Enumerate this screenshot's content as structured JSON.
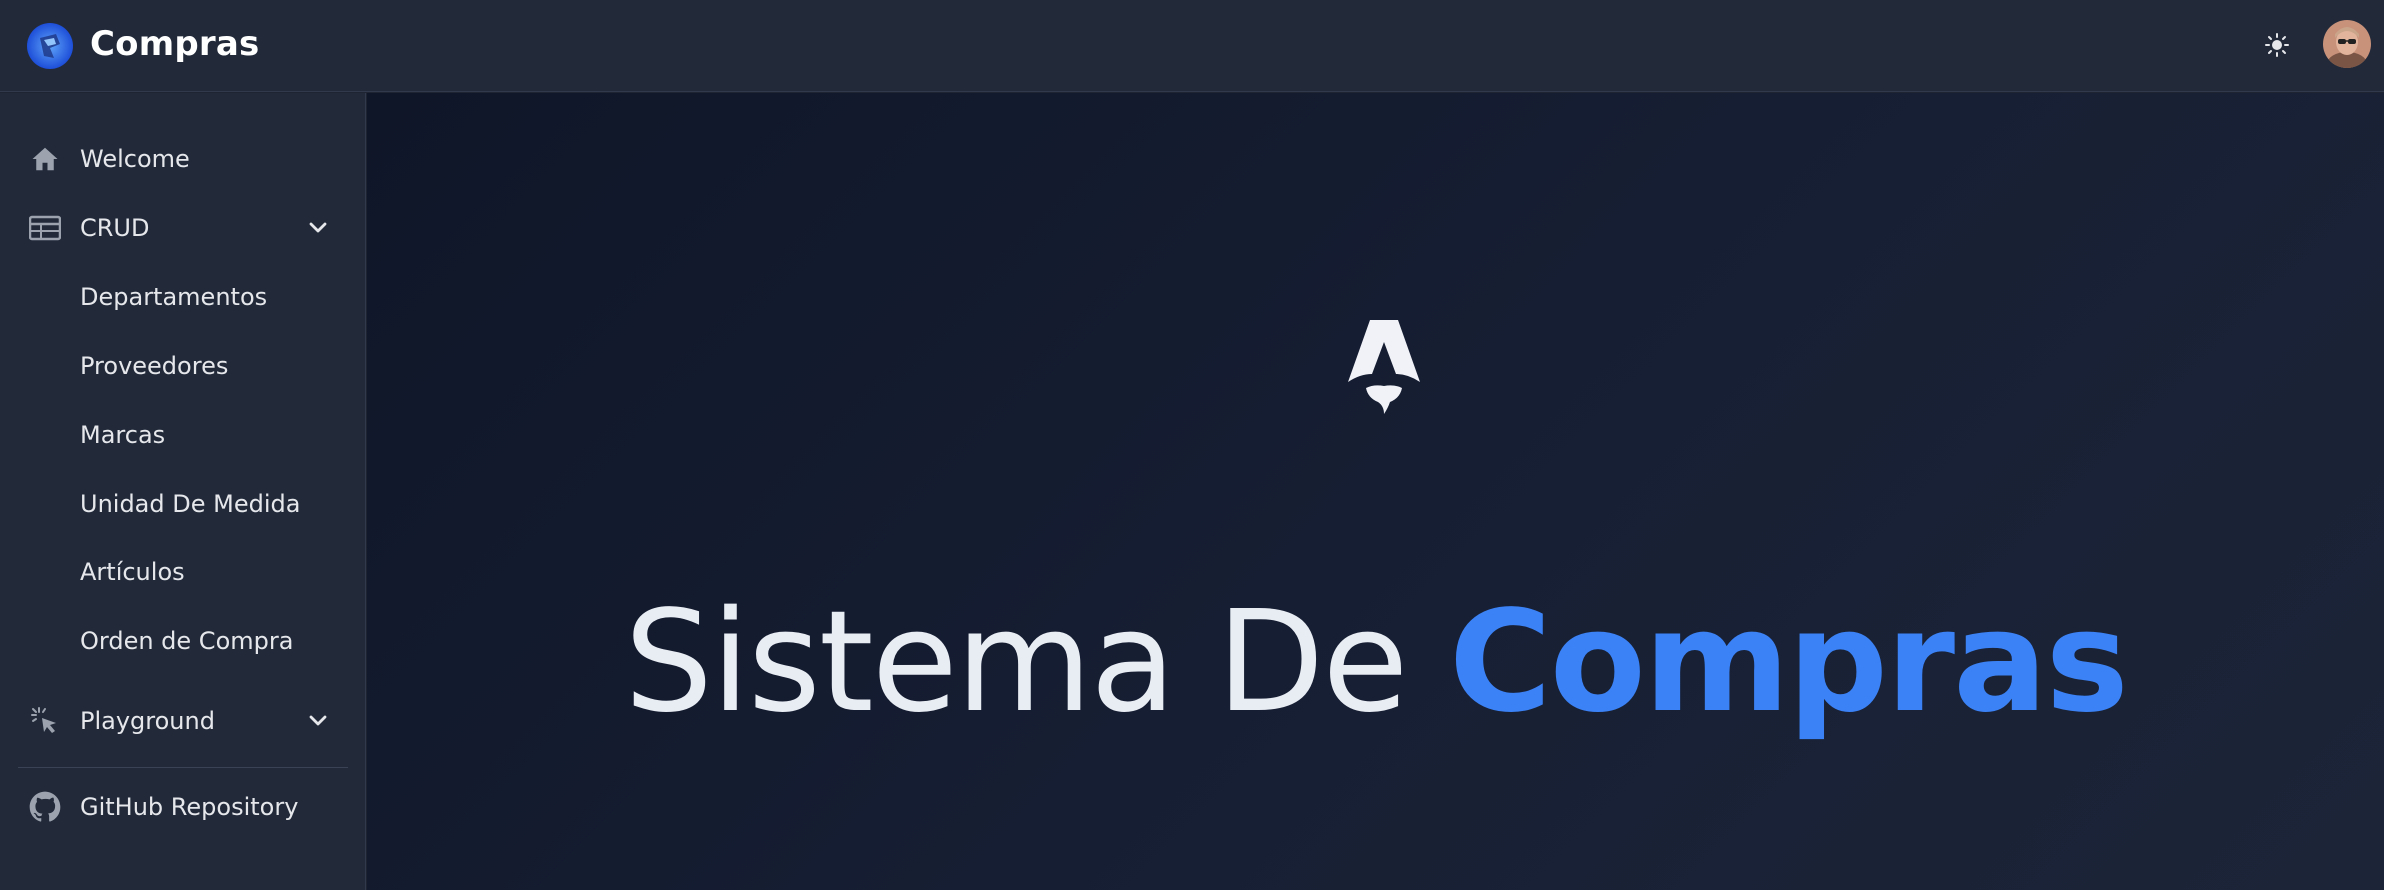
{
  "app": {
    "title": "Compras",
    "colors": {
      "accent": "#3b82f6",
      "background": "#1e2432",
      "sidebar": "#222a3a"
    }
  },
  "header": {
    "theme_toggle_icon": "sun-icon",
    "avatar_icon": "user-avatar"
  },
  "sidebar": {
    "items": [
      {
        "label": "Welcome",
        "icon": "home-icon"
      },
      {
        "label": "CRUD",
        "icon": "table-icon",
        "expanded": true,
        "children": [
          {
            "label": "Departamentos"
          },
          {
            "label": "Proveedores"
          },
          {
            "label": "Marcas"
          },
          {
            "label": "Unidad De Medida"
          },
          {
            "label": "Artículos"
          },
          {
            "label": "Orden de Compra"
          }
        ]
      },
      {
        "label": "Playground",
        "icon": "cursor-click-icon",
        "expanded": false
      },
      {
        "label": "GitHub Repository",
        "icon": "github-icon"
      }
    ]
  },
  "hero": {
    "logo_icon": "astro-logo",
    "title_light": "Sistema De",
    "title_accent": "Compras"
  }
}
